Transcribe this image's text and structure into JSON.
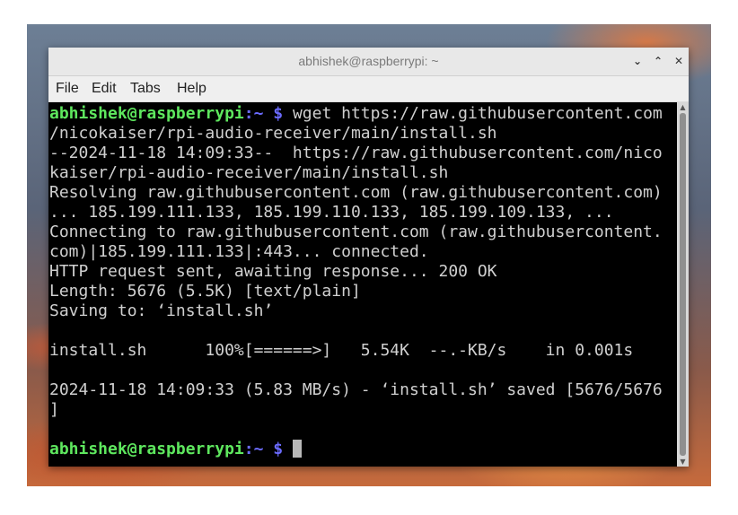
{
  "window": {
    "title": "abhishek@raspberrypi: ~",
    "controls": {
      "minimize": "⌄",
      "maximize": "⌃",
      "close": "✕"
    }
  },
  "menu": {
    "file": "File",
    "edit": "Edit",
    "tabs": "Tabs",
    "help": "Help"
  },
  "terminal": {
    "prompt1": {
      "user": "abhishek@raspberrypi",
      "path": ":~ $",
      "command": " wget https://raw.githubusercontent.com\n/nicokaiser/rpi-audio-receiver/main/install.sh"
    },
    "output": "--2024-11-18 14:09:33--  https://raw.githubusercontent.com/nico\nkaiser/rpi-audio-receiver/main/install.sh\nResolving raw.githubusercontent.com (raw.githubusercontent.com)\n... 185.199.111.133, 185.199.110.133, 185.199.109.133, ...\nConnecting to raw.githubusercontent.com (raw.githubusercontent.\ncom)|185.199.111.133|:443... connected.\nHTTP request sent, awaiting response... 200 OK\nLength: 5676 (5.5K) [text/plain]\nSaving to: ‘install.sh’\n\ninstall.sh      100%[======>]   5.54K  --.-KB/s    in 0.001s\n\n2024-11-18 14:09:33 (5.83 MB/s) - ‘install.sh’ saved [5676/5676\n]\n\n",
    "prompt2": {
      "user": "abhishek@raspberrypi",
      "path": ":~ $",
      "command": " "
    }
  },
  "scrollbar": {
    "up_arrow": "▲",
    "down_arrow": "▼"
  }
}
